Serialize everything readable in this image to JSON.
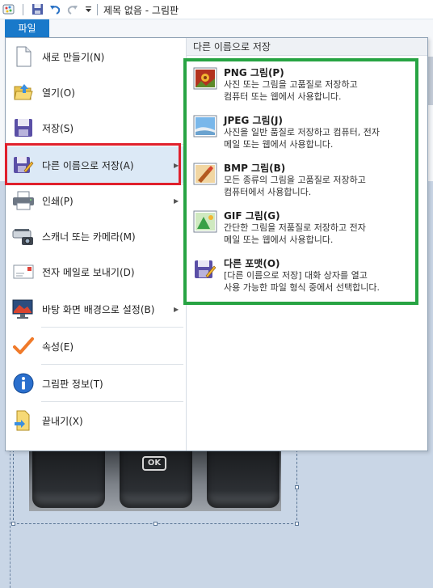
{
  "window": {
    "title": "제목 없음 - 그림판"
  },
  "quick_access": {
    "items": [
      "paint-app-icon",
      "save-icon",
      "undo-icon",
      "redo-icon",
      "customize-dropdown-icon"
    ]
  },
  "file_tab": {
    "label": "파일"
  },
  "menu": {
    "items": [
      {
        "label": "새로 만들기(N)",
        "icon": "new-document-icon"
      },
      {
        "label": "열기(O)",
        "icon": "open-folder-icon"
      },
      {
        "label": "저장(S)",
        "icon": "save-disk-icon"
      },
      {
        "label": "다른 이름으로 저장(A)",
        "icon": "save-as-icon",
        "submenu": true
      },
      {
        "label": "인쇄(P)",
        "icon": "printer-icon",
        "submenu": true
      },
      {
        "label": "스캐너 또는 카메라(M)",
        "icon": "scanner-camera-icon"
      },
      {
        "label": "전자 메일로 보내기(D)",
        "icon": "email-icon"
      },
      {
        "label": "바탕 화면 배경으로 설정(B)",
        "icon": "desktop-background-icon",
        "submenu": true
      },
      {
        "label": "속성(E)",
        "icon": "checkmark-icon"
      },
      {
        "label": "그림판 정보(T)",
        "icon": "info-icon"
      },
      {
        "label": "끝내기(X)",
        "icon": "exit-icon"
      }
    ]
  },
  "save_as": {
    "header": "다른 이름으로 저장",
    "options": [
      {
        "title": "PNG 그림(P)",
        "desc": "사진 또는 그림을 고품질로 저장하고\n컴퓨터 또는 웹에서 사용합니다."
      },
      {
        "title": "JPEG 그림(J)",
        "desc": "사진을 일반 품질로 저장하고 컴퓨터, 전자\n메일 또는 웹에서 사용합니다."
      },
      {
        "title": "BMP 그림(B)",
        "desc": "모든 종류의 그림을 고품질로 저장하고\n컴퓨터에서 사용합니다."
      },
      {
        "title": "GIF 그림(G)",
        "desc": "간단한 그림을 저품질로 저장하고 전자\n메일 또는 웹에서 사용합니다."
      },
      {
        "title": "다른 포맷(O)",
        "desc": "[다른 이름으로 저장] 대화 상자를 열고\n사용 가능한 파일 형식 중에서 선택합니다."
      }
    ]
  },
  "canvas": {
    "key_label": "OK"
  },
  "colors": {
    "file_tab": "#1979ca",
    "highlight_red": "#e0202c",
    "highlight_green": "#27a443",
    "menu_selected": "#dce9f6"
  }
}
